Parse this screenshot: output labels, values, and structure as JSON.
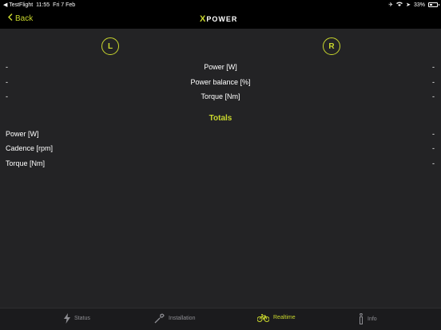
{
  "statusbar": {
    "back_app": "◀ TestFlight",
    "time": "11:55",
    "date": "Fri 7 Feb",
    "battery": "33%",
    "battery_level": 0.33
  },
  "nav": {
    "back_label": "Back",
    "logo_text": "POWER"
  },
  "sides": {
    "left": "L",
    "right": "R"
  },
  "per_side_rows": [
    {
      "label": "Power [W]",
      "left": "-",
      "right": "-"
    },
    {
      "label": "Power balance [%]",
      "left": "-",
      "right": "-"
    },
    {
      "label": "Torque [Nm]",
      "left": "-",
      "right": "-"
    }
  ],
  "totals": {
    "title": "Totals",
    "rows": [
      {
        "label": "Power [W]",
        "value": "-"
      },
      {
        "label": "Cadence [rpm]",
        "value": "-"
      },
      {
        "label": "Torque [Nm]",
        "value": "-"
      }
    ]
  },
  "tabs": [
    {
      "label": "Status",
      "icon": "lightning-icon"
    },
    {
      "label": "Installation",
      "icon": "wrench-icon"
    },
    {
      "label": "Realtime",
      "icon": "bicycle-icon",
      "active": true
    },
    {
      "label": "Info",
      "icon": "info-icon"
    }
  ],
  "colors": {
    "accent": "#c9d72d",
    "background": "#232325",
    "bar": "#000000"
  }
}
